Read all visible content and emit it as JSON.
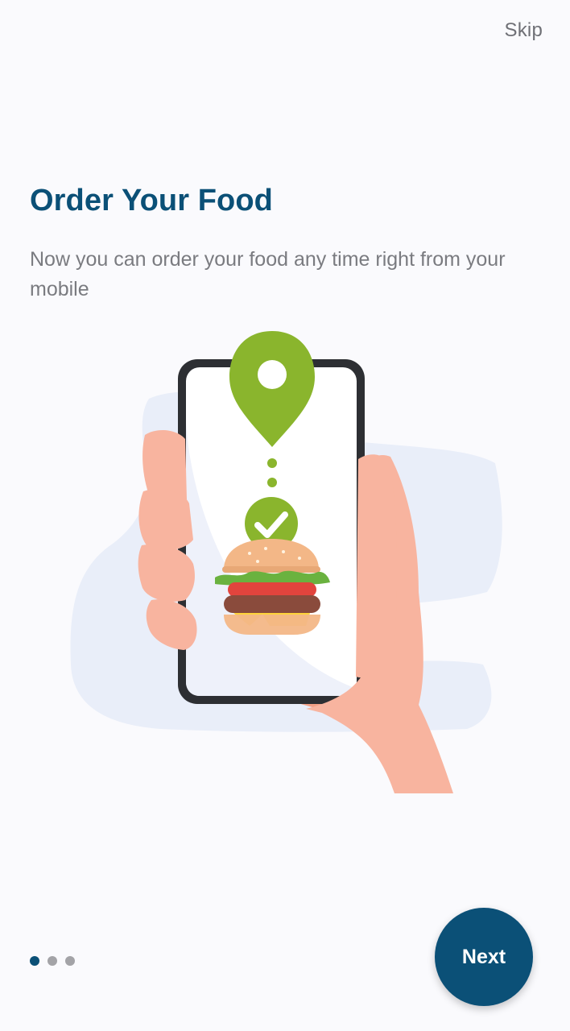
{
  "header": {
    "skip_label": "Skip"
  },
  "onboarding": {
    "title": "Order Your Food",
    "description": "Now you can order your food any time right from your mobile",
    "illustration_icon": "hand-holding-phone-burger-illustration"
  },
  "pager": {
    "total_pages": 3,
    "current_page": 1
  },
  "footer": {
    "next_label": "Next"
  },
  "colors": {
    "primary": "#0b5077",
    "accent_green": "#8ab52d",
    "background": "#fafafd",
    "muted_text": "#7a7b80"
  }
}
